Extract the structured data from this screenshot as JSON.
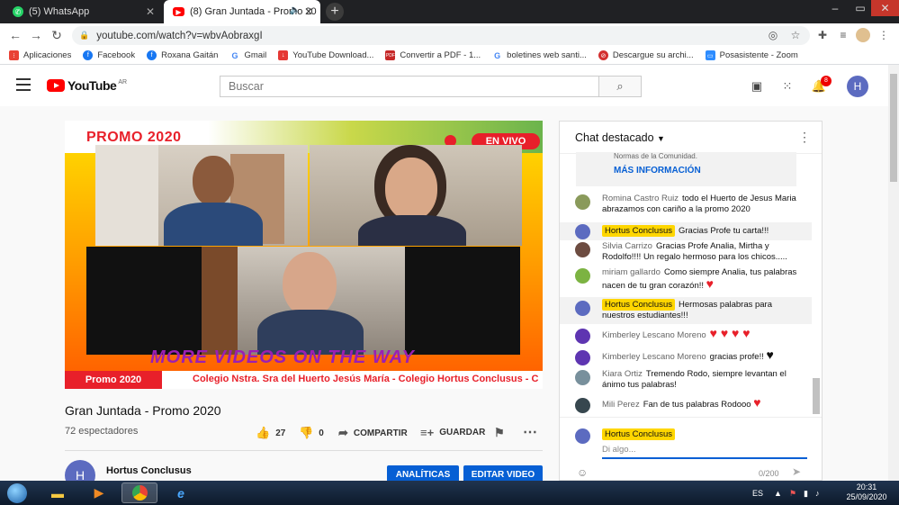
{
  "browser": {
    "tabs": [
      {
        "title": "(5) WhatsApp",
        "icon": "whatsapp-icon",
        "color": "#25d366"
      },
      {
        "title": "(8) Gran Juntada - Promo 20",
        "icon": "youtube-icon",
        "color": "#ff0000"
      }
    ],
    "url": "youtube.com/watch?v=wbvAobraxgI",
    "bookmarks": [
      {
        "label": "Aplicaciones",
        "color": "#e94235"
      },
      {
        "label": "Facebook",
        "color": "#1877f2"
      },
      {
        "label": "Roxana Gaitán",
        "color": "#1877f2"
      },
      {
        "label": "Gmail",
        "color": "#4285f4"
      },
      {
        "label": "YouTube Download...",
        "color": "#e53935"
      },
      {
        "label": "Convertir a PDF - 1...",
        "color": "#c62828"
      },
      {
        "label": "boletines web santi...",
        "color": "#4285f4"
      },
      {
        "label": "Descargue su archi...",
        "color": "#d32f2f"
      },
      {
        "label": "Posasistente - Zoom",
        "color": "#2d8cff"
      }
    ]
  },
  "youtube": {
    "logo": "YouTube",
    "region": "AR",
    "search_placeholder": "Buscar",
    "notifications": "8",
    "avatar_letter": "H"
  },
  "video": {
    "overlay_title": "PROMO 2020",
    "live_badge": "EN VIVO",
    "more_videos": "MORE VIDEOS ON THE WAY",
    "ticker_badge": "Promo 2020",
    "ticker_text": "Colegio Nstra. Sra del Huerto Jesús María - Colegio Hortus Conclusus - C",
    "title": "Gran Juntada - Promo 2020",
    "views": "72 espectadores",
    "likes": "27",
    "dislikes": "0",
    "share": "COMPARTIR",
    "save": "GUARDAR"
  },
  "channel": {
    "name": "Hortus Conclusus",
    "avatar_letter": "H",
    "analytics": "ANALÍTICAS",
    "edit": "EDITAR VIDEO"
  },
  "chat": {
    "header": "Chat destacado",
    "rules_text": "Normas de la Comunidad.",
    "more_info": "MÁS INFORMACIÓN",
    "messages": [
      {
        "author": "Romina Castro Ruiz",
        "text": "todo el Huerto de Jesus Maria abrazamos con cariño a la promo 2020",
        "own": false,
        "color": "#8a9a5b"
      },
      {
        "author": "Hortus Conclusus",
        "text": "Gracias Profe tu carta!!!",
        "own": true,
        "color": "#5c6bc0"
      },
      {
        "author": "Silvia Carrizo",
        "text": "Gracias Profe Analia, Mirtha y Rodolfo!!!! Un regalo hermoso para los chicos.....",
        "own": false,
        "color": "#6d4c41"
      },
      {
        "author": "miriam gallardo",
        "text": "Como siempre Analia, tus palabras nacen de tu gran corazón!!",
        "own": false,
        "color": "#7cb342"
      },
      {
        "author": "Hortus Conclusus",
        "text": "Hermosas palabras para nuestros estudiantes!!!",
        "own": true,
        "color": "#5c6bc0"
      },
      {
        "author": "Kimberley Lescano Moreno",
        "text": "",
        "own": false,
        "color": "#5e35b1"
      },
      {
        "author": "Kimberley Lescano Moreno",
        "text": "gracias profe!!",
        "own": false,
        "color": "#5e35b1"
      },
      {
        "author": "Kiara Ortiz",
        "text": "Tremendo Rodo, siempre levantan el ánimo tus palabras!",
        "own": false,
        "color": "#78909c"
      },
      {
        "author": "Mili Perez",
        "text": "Fan de tus palabras Rodooo",
        "own": false,
        "color": "#37474f"
      }
    ],
    "input_user": "Hortus Conclusus",
    "input_placeholder": "Di algo...",
    "char_count": "0/200"
  },
  "taskbar": {
    "lang": "ES",
    "time": "20:31",
    "date": "25/09/2020"
  }
}
